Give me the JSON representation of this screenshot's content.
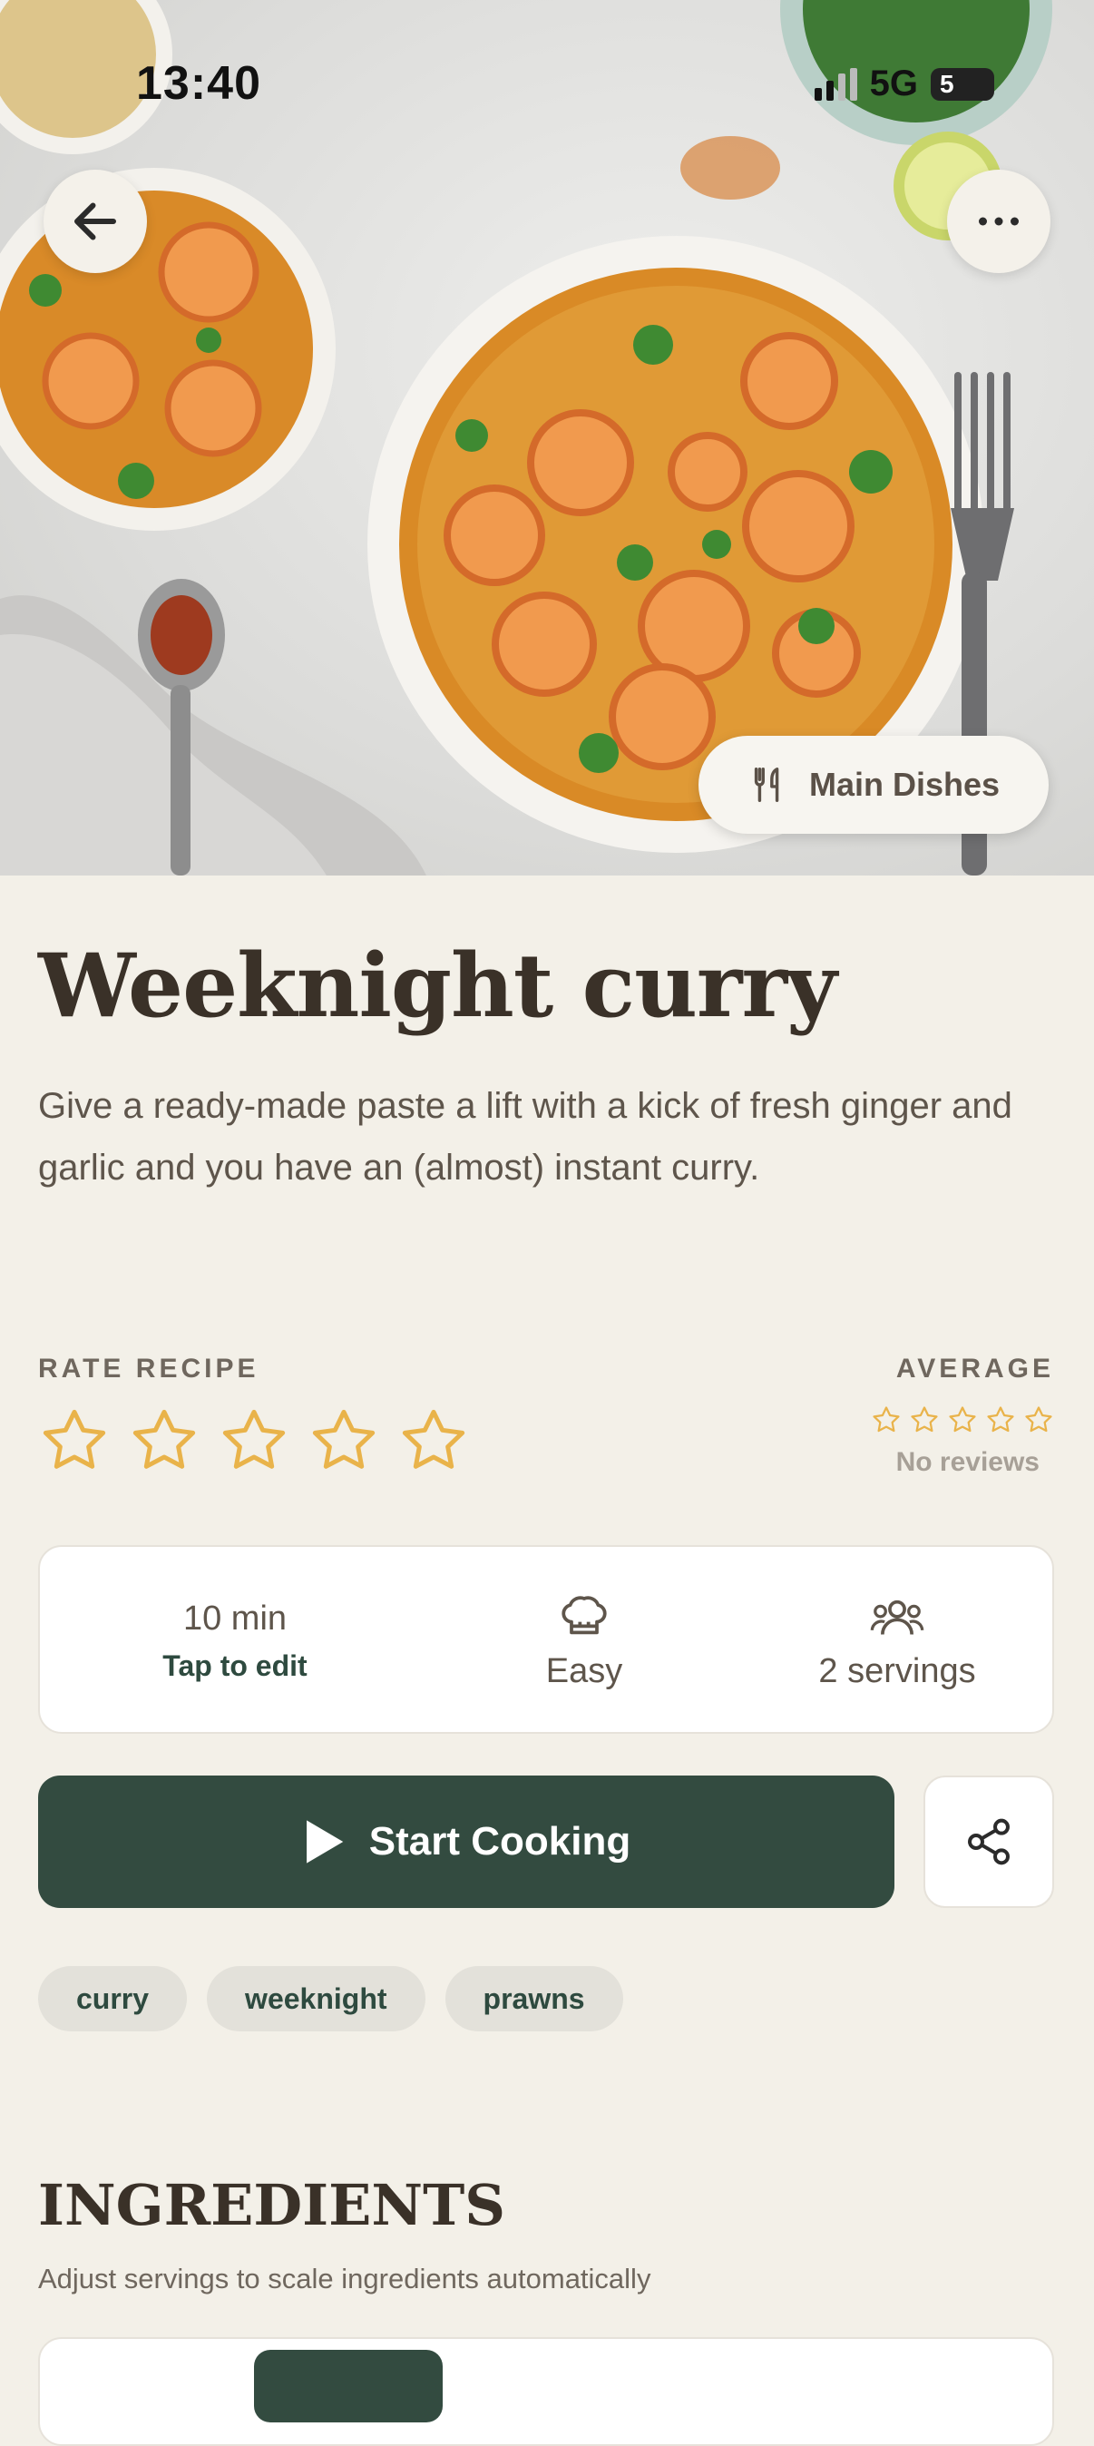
{
  "status_bar": {
    "time": "13:40",
    "network": "5G",
    "battery": "5"
  },
  "hero": {
    "image_alt": "Bowls of prawn curry with herbs, fork and spoon on a light table",
    "category": "Main Dishes",
    "back_icon": "arrow-left-icon",
    "more_icon": "ellipsis-icon",
    "category_icon": "fork-knife-icon"
  },
  "recipe": {
    "title": "Weeknight curry",
    "description": "Give a ready-made paste a lift with a kick of fresh ginger and garlic and you have an (almost) instant curry."
  },
  "rating": {
    "rate_label": "RATE RECIPE",
    "user_rating": 0,
    "max_rating": 5,
    "average_label": "AVERAGE",
    "average_rating": 0,
    "reviews_text": "No reviews",
    "star_color": "#e9b34a"
  },
  "info": {
    "time": "10 min",
    "time_hint": "Tap to edit",
    "difficulty": "Easy",
    "difficulty_icon": "chef-hat-icon",
    "servings": "2 servings",
    "servings_icon": "people-icon"
  },
  "actions": {
    "start_label": "Start Cooking",
    "start_icon": "play-icon",
    "share_icon": "share-icon",
    "accent": "#334b40"
  },
  "tags": [
    "curry",
    "weeknight",
    "prawns"
  ],
  "ingredients": {
    "title": "INGREDIENTS",
    "subtitle": "Adjust servings to scale ingredients automatically"
  }
}
